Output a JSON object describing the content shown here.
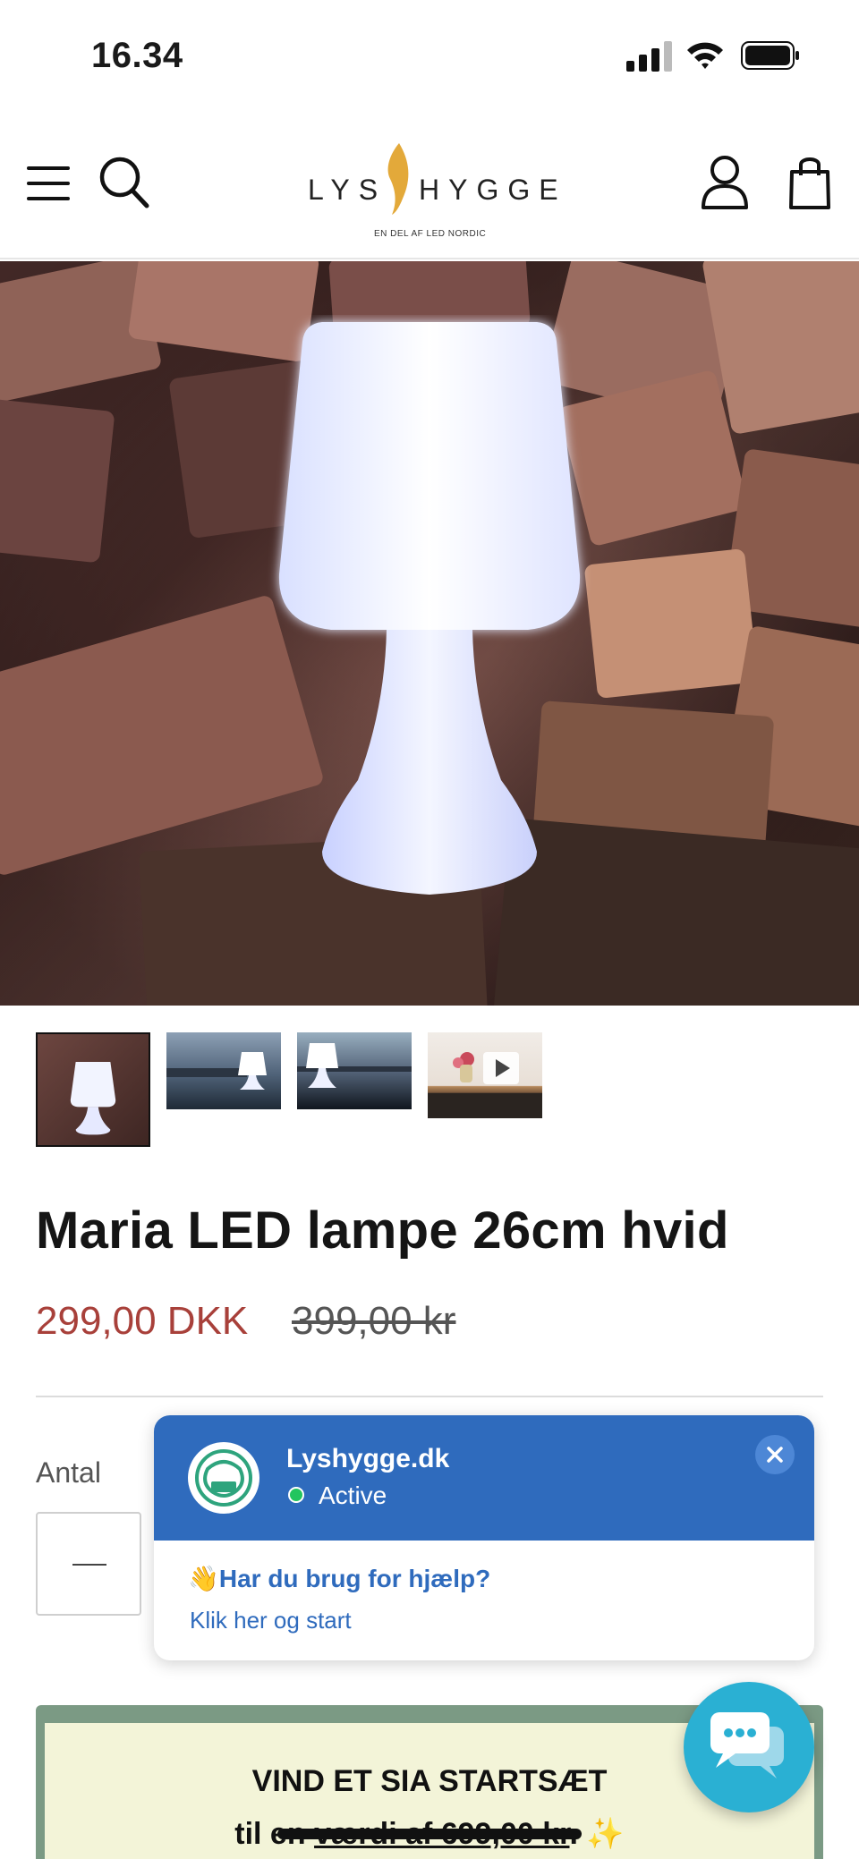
{
  "status_bar": {
    "time": "16.34",
    "icons": [
      "signal-icon",
      "wifi-icon",
      "battery-icon"
    ]
  },
  "header": {
    "menu_icon": "hamburger-menu-icon",
    "search_icon": "search-icon",
    "logo": {
      "left": "LYS",
      "right": "HYGGE",
      "tagline": "EN DEL AF LED NORDIC"
    },
    "account_icon": "user-icon",
    "cart_icon": "shopping-bag-icon"
  },
  "gallery": {
    "thumbnails": [
      "thumb-lamp-firewood",
      "thumb-lamp-harbor",
      "thumb-lamp-lake",
      "thumb-video-table"
    ],
    "video_icon": "play-icon"
  },
  "product": {
    "title": "Maria LED lampe 26cm hvid",
    "price_sale": "299,00 DKK",
    "price_old": "399,00 kr"
  },
  "quantity": {
    "label": "Antal"
  },
  "promo": {
    "line1": "VIND ET SIA STARTSÆT",
    "line2_prefix": "til en ",
    "line2_underlined": "værdi af 699,00 kr",
    "line2_suffix": ". ✨"
  },
  "chat": {
    "name": "Lyshygge.dk",
    "status": "Active",
    "question": "👋Har du brug for hjælp?",
    "subtitle": "Klik her og start"
  },
  "colors": {
    "sale_price": "#a8403a",
    "chat_header": "#2f6bbd",
    "chat_fab": "#2ab0d3",
    "promo_border": "#7b9a84",
    "promo_bg": "#f3f4d8"
  }
}
